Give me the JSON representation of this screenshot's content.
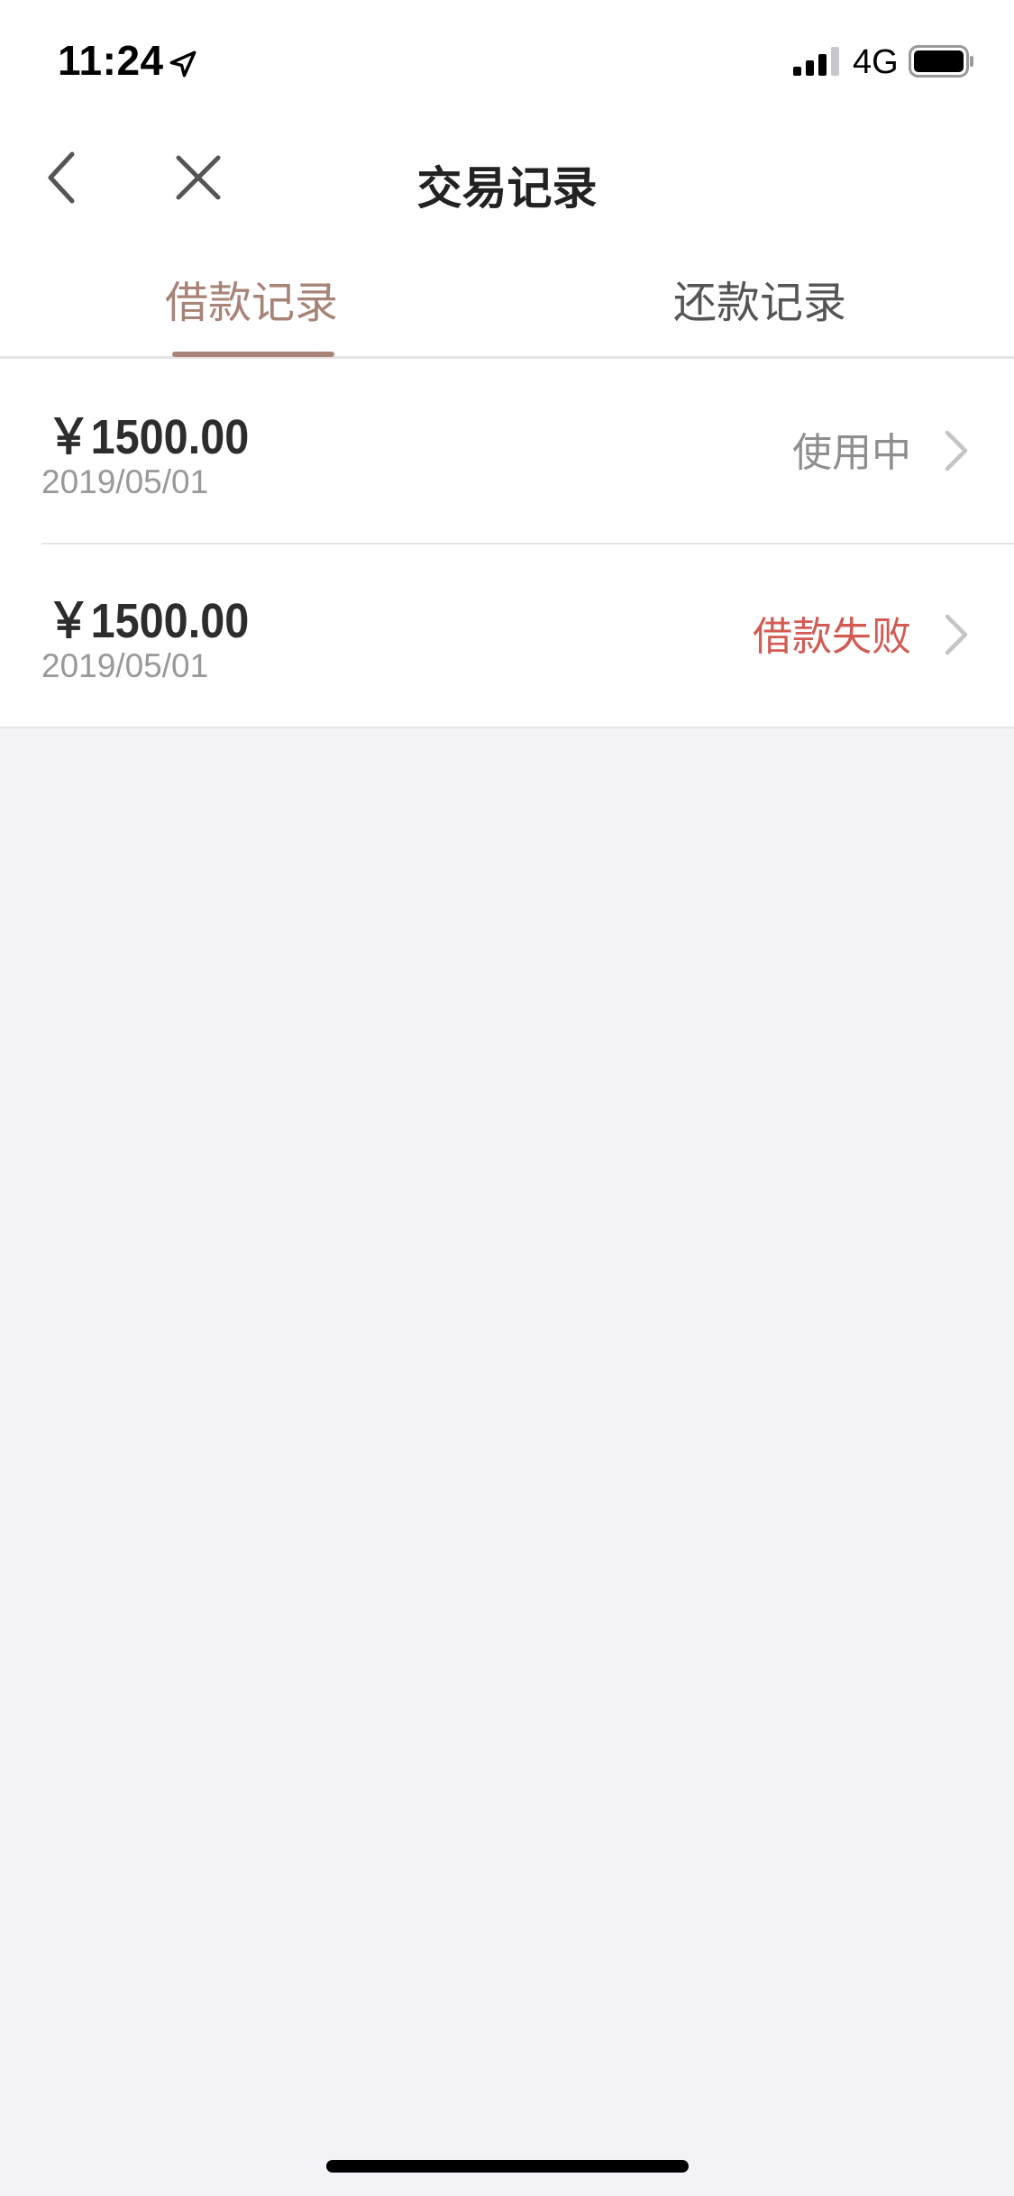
{
  "status_bar": {
    "time": "11:24",
    "network": "4G",
    "icons": [
      "location-arrow-icon",
      "signal-bars-icon",
      "battery-icon"
    ]
  },
  "nav": {
    "title": "交易记录",
    "back_icon": "chevron-left-icon",
    "close_icon": "close-icon"
  },
  "tabs": [
    {
      "label": "借款记录",
      "active": true
    },
    {
      "label": "还款记录",
      "active": false
    }
  ],
  "records": [
    {
      "amount": "￥1500.00",
      "date": "2019/05/01",
      "status": "使用中",
      "status_color": "#8e8e8e"
    },
    {
      "amount": "￥1500.00",
      "date": "2019/05/01",
      "status": "借款失败",
      "status_color": "#d25b54"
    }
  ],
  "colors": {
    "accent": "#a88478",
    "failed": "#d25b54",
    "background": "#f2f2f7"
  }
}
